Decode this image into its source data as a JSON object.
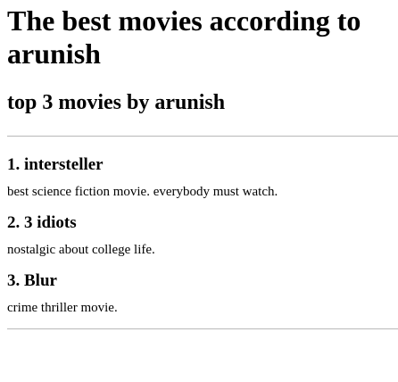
{
  "header": {
    "title": "The best movies according to arunish",
    "subtitle": "top 3 movies by arunish"
  },
  "movies": [
    {
      "heading": "1. intersteller",
      "description": "best science fiction movie. everybody must watch."
    },
    {
      "heading": "2. 3 idiots",
      "description": "nostalgic about college life."
    },
    {
      "heading": "3. Blur",
      "description": "crime thriller movie."
    }
  ]
}
